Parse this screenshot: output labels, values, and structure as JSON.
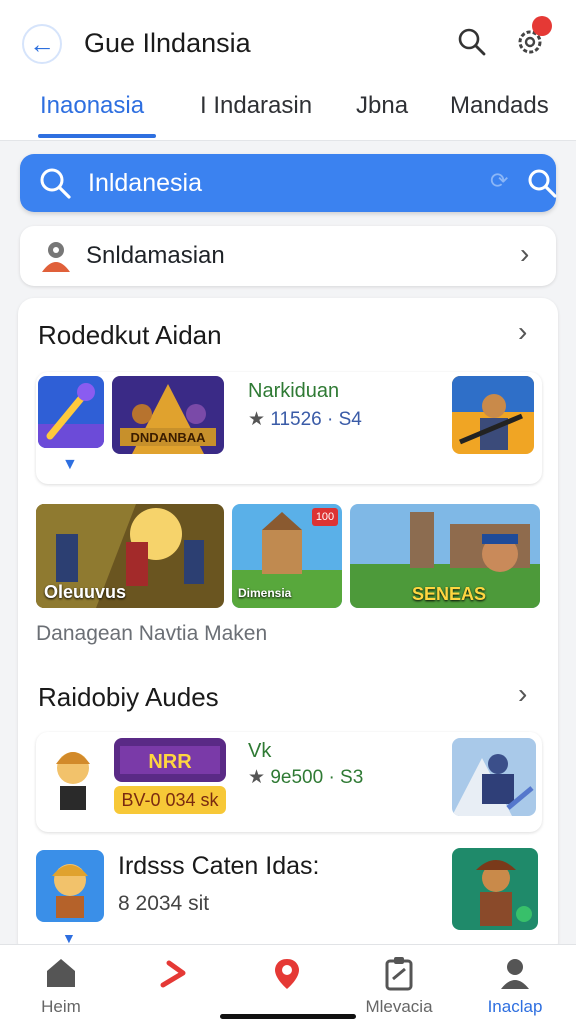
{
  "header": {
    "title": "Gue Ilndansia",
    "icons": [
      "back-arrow-icon",
      "search-icon",
      "settings-gear-icon"
    ]
  },
  "tabs": [
    {
      "label": "Inaonasia",
      "active": true
    },
    {
      "label": "I Indarasin",
      "active": false
    },
    {
      "label": "Jbna",
      "active": false
    },
    {
      "label": "Mandads",
      "active": false
    }
  ],
  "search": {
    "value": "Inldanesia"
  },
  "location": {
    "label": "Snldamasian"
  },
  "section1": {
    "title": "Rodedkut Aidan",
    "card": {
      "game_banner_text": "DNDANBAA",
      "name": "Narkiduan",
      "stats": "11526 · S4"
    },
    "tiles": [
      {
        "caption": "Oleuuvus"
      },
      {
        "caption": "Dimensia",
        "badge": "100"
      },
      {
        "caption": "SENEAS"
      }
    ],
    "footer": "Danagean Navtia Maken"
  },
  "section2": {
    "title": "Raidobiy Audes",
    "card": {
      "banner_text": "NRR",
      "year_tag": "BV-0 034 sk",
      "name": "Vk",
      "stats": "9e500 · S3"
    },
    "item": {
      "name": "Irdsss Caten Idas:",
      "meta": "8 2034 sit"
    }
  },
  "bottom_nav": [
    {
      "label": "Heim",
      "icon": "home-icon",
      "active": false
    },
    {
      "label": "",
      "icon": "trending-icon",
      "active": false
    },
    {
      "label": "",
      "icon": "location-pin-icon",
      "active": false
    },
    {
      "label": "Mlevacia",
      "icon": "clipboard-icon",
      "active": false
    },
    {
      "label": "Inaclap",
      "icon": "profile-icon",
      "active": true
    }
  ],
  "colors": {
    "accent": "#2e6fe0",
    "search_bg": "#3b82f0",
    "badge_red": "#e53935",
    "green_text": "#2f7a34"
  }
}
